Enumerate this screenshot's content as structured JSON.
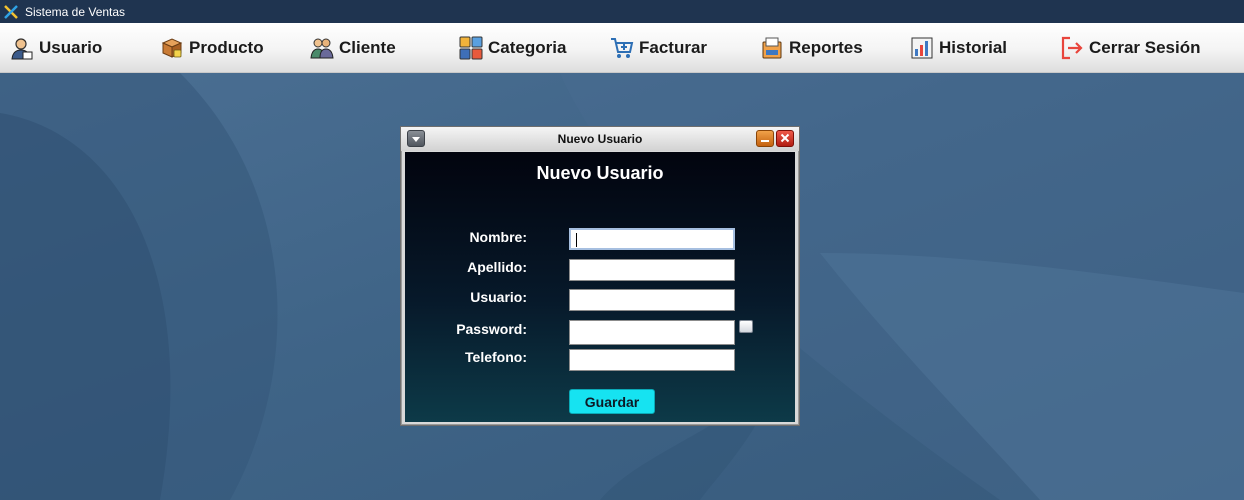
{
  "window": {
    "title": "Sistema de Ventas",
    "icon": "app-cross-icon"
  },
  "menu": {
    "items": [
      {
        "label": "Usuario",
        "icon": "user-icon"
      },
      {
        "label": "Producto",
        "icon": "box-icon"
      },
      {
        "label": "Cliente",
        "icon": "clients-icon"
      },
      {
        "label": "Categoria",
        "icon": "categories-icon"
      },
      {
        "label": "Facturar",
        "icon": "cart-icon"
      },
      {
        "label": "Reportes",
        "icon": "report-icon"
      },
      {
        "label": "Historial",
        "icon": "chart-icon"
      },
      {
        "label": "Cerrar Sesión",
        "icon": "logout-icon"
      }
    ]
  },
  "dialog": {
    "title": "Nuevo Usuario",
    "heading": "Nuevo Usuario",
    "fields": {
      "nombre": {
        "label": "Nombre:",
        "value": ""
      },
      "apellido": {
        "label": "Apellido:",
        "value": ""
      },
      "usuario": {
        "label": "Usuario:",
        "value": ""
      },
      "password": {
        "label": "Password:",
        "value": "",
        "show_password_checked": false
      },
      "telefono": {
        "label": "Telefono:",
        "value": ""
      }
    },
    "submit_label": "Guardar"
  },
  "colors": {
    "titlebar": "#1f3450",
    "desktop": "#3f6486",
    "panel_top": "#02040e",
    "panel_bottom": "#0d3a48",
    "button": "#16e3f1",
    "logout_accent": "#e8453c"
  }
}
